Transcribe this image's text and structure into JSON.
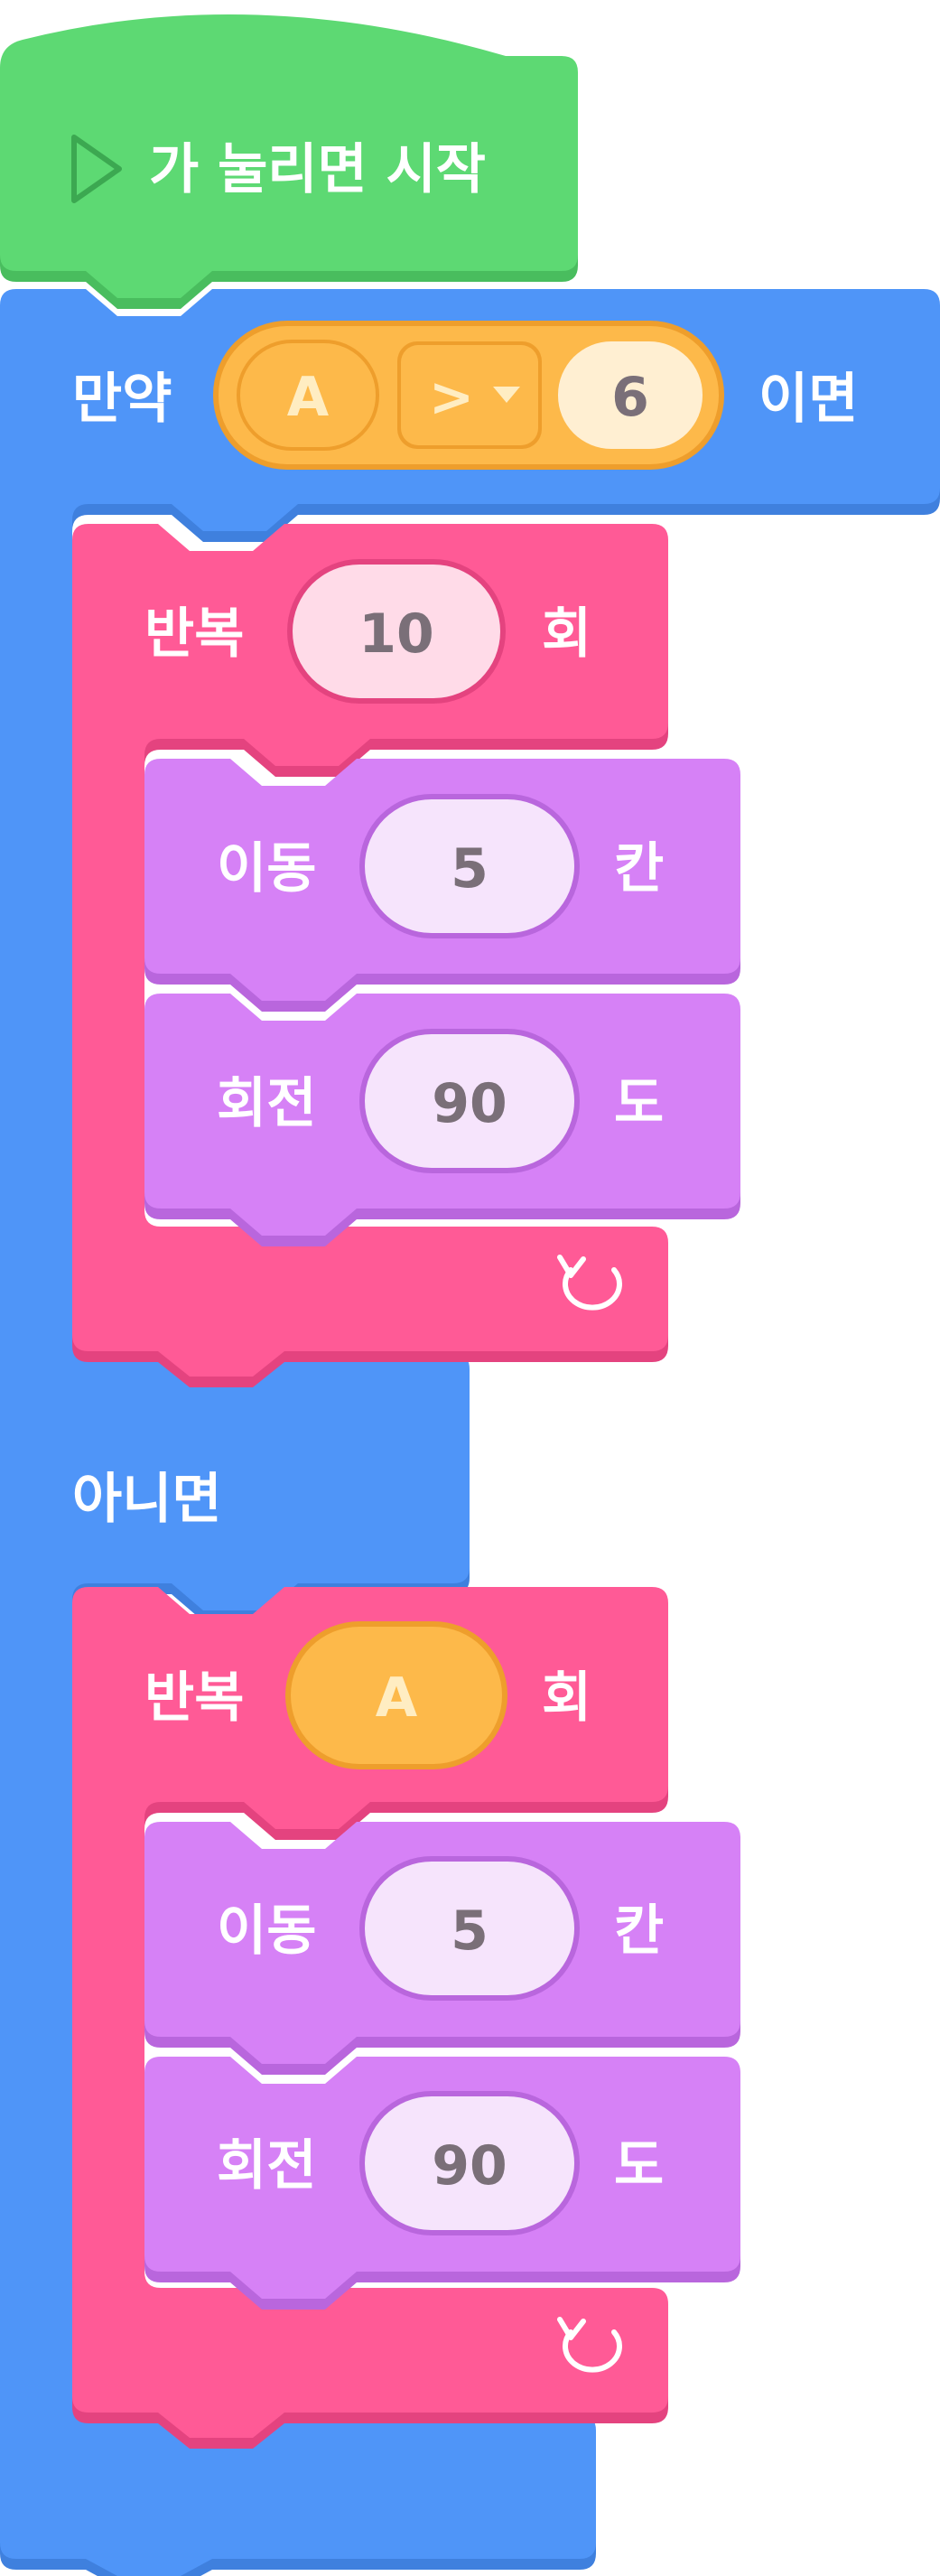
{
  "colors": {
    "event": "#5dd973",
    "event_dark": "#49bd5e",
    "control": "#4f95f8",
    "control_dark": "#3f80de",
    "loop": "#ff5a96",
    "loop_dark": "#e4437f",
    "motion": "#d681f6",
    "motion_dark": "#b966dd",
    "variable": "#fdb94a",
    "variable_dark": "#ee9e2c"
  },
  "event_block": {
    "label": "가 눌리면 시작",
    "icon": "play-triangle-icon"
  },
  "if_block": {
    "if_label": "만약",
    "then_label": "이면",
    "else_label": "아니면",
    "condition": {
      "left": "A",
      "operator": ">",
      "operator_icon": "dropdown-arrow-icon",
      "right": "6"
    }
  },
  "repeat_1": {
    "label": "반복",
    "count": "10",
    "unit": "회",
    "icon": "loop-arrow-icon",
    "move": {
      "label": "이동",
      "value": "5",
      "unit": "칸"
    },
    "turn": {
      "label": "회전",
      "value": "90",
      "unit": "도"
    }
  },
  "repeat_2": {
    "label": "반복",
    "count": "A",
    "unit": "회",
    "icon": "loop-arrow-icon",
    "move": {
      "label": "이동",
      "value": "5",
      "unit": "칸"
    },
    "turn": {
      "label": "회전",
      "value": "90",
      "unit": "도"
    }
  }
}
